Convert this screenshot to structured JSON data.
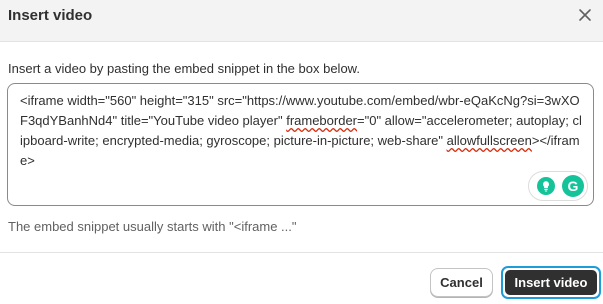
{
  "dialog": {
    "title": "Insert video",
    "close_icon": "close-icon",
    "instruction": "Insert a video by pasting the embed snippet in the box below.",
    "help_text": "The embed snippet usually starts with \"<iframe ...\"",
    "cancel_label": "Cancel",
    "insert_label": "Insert video"
  },
  "editor": {
    "code_before_frameborder": "<iframe width=\"560\" height=\"315\" src=\"https://www.youtube.com/embed/wbr-eQaKcNg?si=3wXOF3qdYBanhNd4\" title=\"YouTube video player\" ",
    "frameborder_word": "frameborder",
    "code_middle": "=\"0\" allow=\"accelerometer; autoplay; clipboard-write; encrypted-media; gyroscope; picture-in-picture; web-share\" ",
    "allowfullscreen_word": "allowfullscreen",
    "code_end": "></iframe>"
  },
  "extensions": {
    "bulb_icon": "lightbulb-icon",
    "grammarly_icon": "grammarly-icon",
    "grammarly_letter": "G"
  },
  "colors": {
    "primary_button": "#303030",
    "focus_ring": "#1e9bd9",
    "grammarly_green": "#15c39a",
    "spellcheck_red": "#d72c0d"
  }
}
